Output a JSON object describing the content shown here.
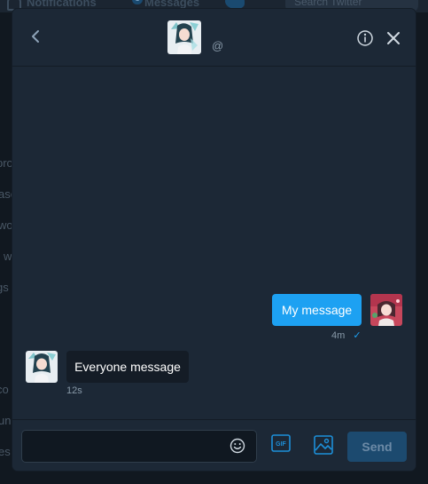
{
  "background": {
    "nav": {
      "notifications_label": "Notifications",
      "messages_label": "Messages",
      "messages_badge": "1",
      "search_placeholder": "Search Twitter"
    },
    "side_fragments": [
      "pro",
      "ase",
      "wo",
      "w",
      "gs",
      "co",
      "un",
      "es"
    ]
  },
  "dm": {
    "header": {
      "handle": "@"
    },
    "messages": [
      {
        "text": "My message",
        "time": "4m",
        "status_icon": "checkmark-icon",
        "from": "self"
      },
      {
        "text": "Everyone message",
        "time": "12s",
        "from": "other"
      }
    ],
    "composer": {
      "placeholder": "",
      "gif_label": "GIF",
      "send_label": "Send"
    }
  },
  "colors": {
    "accent": "#1da1f2",
    "panel": "#1c2836",
    "send_disabled": "#1c4a6f"
  }
}
